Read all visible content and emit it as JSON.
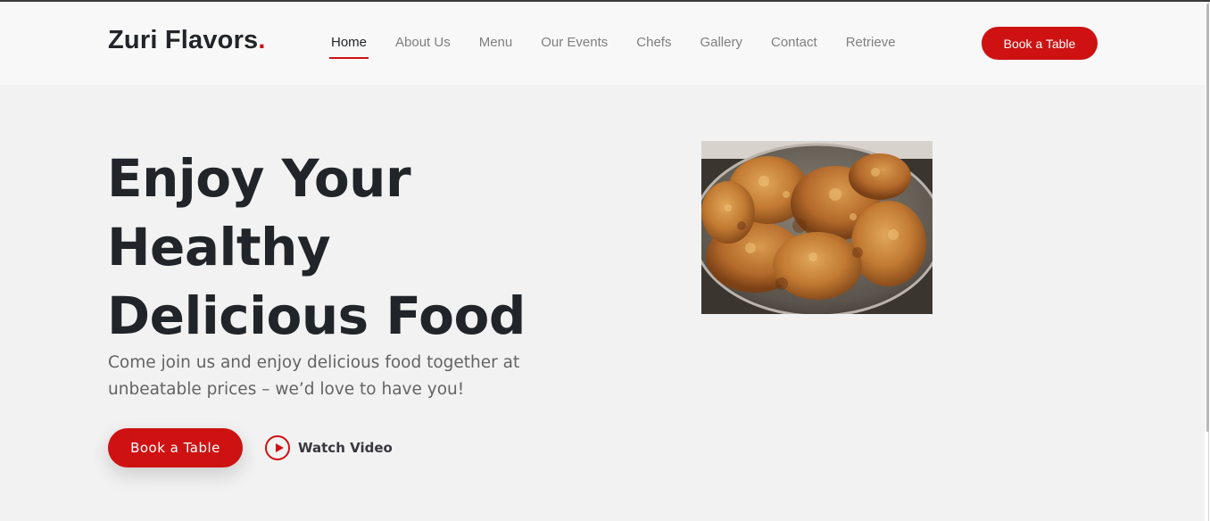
{
  "brand": {
    "name": "Zuri Flavors",
    "dot": ".",
    "accent": "#ce1212"
  },
  "nav": {
    "items": [
      {
        "label": "Home",
        "active": true
      },
      {
        "label": "About Us"
      },
      {
        "label": "Menu"
      },
      {
        "label": "Our Events"
      },
      {
        "label": "Chefs"
      },
      {
        "label": "Gallery"
      },
      {
        "label": "Contact"
      },
      {
        "label": "Retrieve"
      }
    ],
    "cta": "Book a Table"
  },
  "hero": {
    "title_lines": [
      "Enjoy Your",
      "Healthy",
      "Delicious Food"
    ],
    "subtitle": "Come join us and enjoy delicious food together at unbeatable prices – we’d love to have you!",
    "primary_button": "Book a Table",
    "video_link": "Watch Video",
    "video_icon": "play-circle-icon",
    "image": "fried-chicken-photo"
  }
}
